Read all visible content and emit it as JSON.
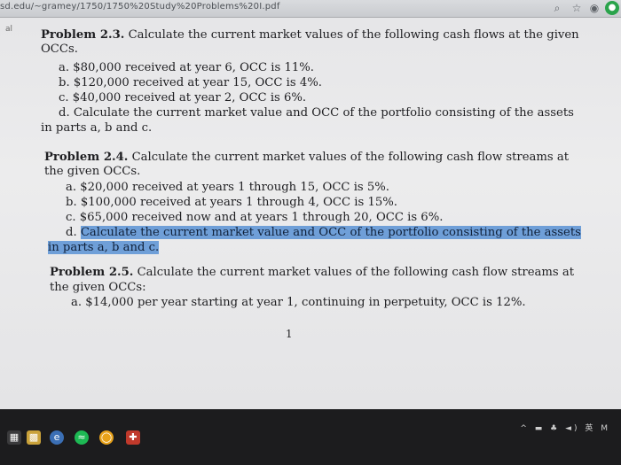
{
  "browser": {
    "url": "sd.edu/~gramey/1750/1750%20Study%20Problems%20I.pdf",
    "icons": [
      "zoom-icon",
      "bookmark-star-icon",
      "extension-icon",
      "extension-green-icon"
    ]
  },
  "document": {
    "margin_mark": "al",
    "lines": [
      {
        "text": "Problem 2.3.  Calculate the current market values of the following cash flows at the given",
        "bold": "Problem 2.3."
      },
      {
        "text": "OCCs."
      },
      {
        "text": "a. $80,000 received at year 6, OCC is 11%."
      },
      {
        "text": "b. $120,000 received at year 15, OCC is 4%."
      },
      {
        "text": "c. $40,000 received at year 2, OCC is 6%."
      },
      {
        "text": "d. Calculate the current market value and OCC of the portfolio consisting of the assets"
      },
      {
        "text": "in parts a, b and c."
      },
      {
        "text": "Problem 2.4.  Calculate the current market values of the following cash flow streams at",
        "bold": "Problem 2.4."
      },
      {
        "text": "the given OCCs."
      },
      {
        "text": "a. $20,000 received at years 1 through 15, OCC is 5%."
      },
      {
        "text": "b. $100,000 received at years 1 through 4, OCC is 15%."
      },
      {
        "text": "c. $65,000 received now and at years 1 through 20, OCC is 6%."
      },
      {
        "text": "Calculate the current market value and OCC of the portfolio consisting of the assets",
        "prefix": "d. ",
        "highlight": true
      },
      {
        "text": "in parts a, b and c.",
        "highlight": true
      },
      {
        "text": "Problem 2.5.  Calculate the current market values of the following cash flow streams at",
        "bold": "Problem 2.5."
      },
      {
        "text": "the given OCCs:"
      },
      {
        "text": "a. $14,000 per year starting at year 1, continuing in perpetuity, OCC is 12%."
      }
    ],
    "page_number": "1"
  },
  "taskbar": {
    "apps": [
      "start-icon",
      "file-explorer-icon",
      "edge-icon",
      "spotify-icon",
      "chrome-icon",
      "foxit-icon"
    ],
    "tray": "^ ▬ ♣ ◄) 英 M"
  }
}
